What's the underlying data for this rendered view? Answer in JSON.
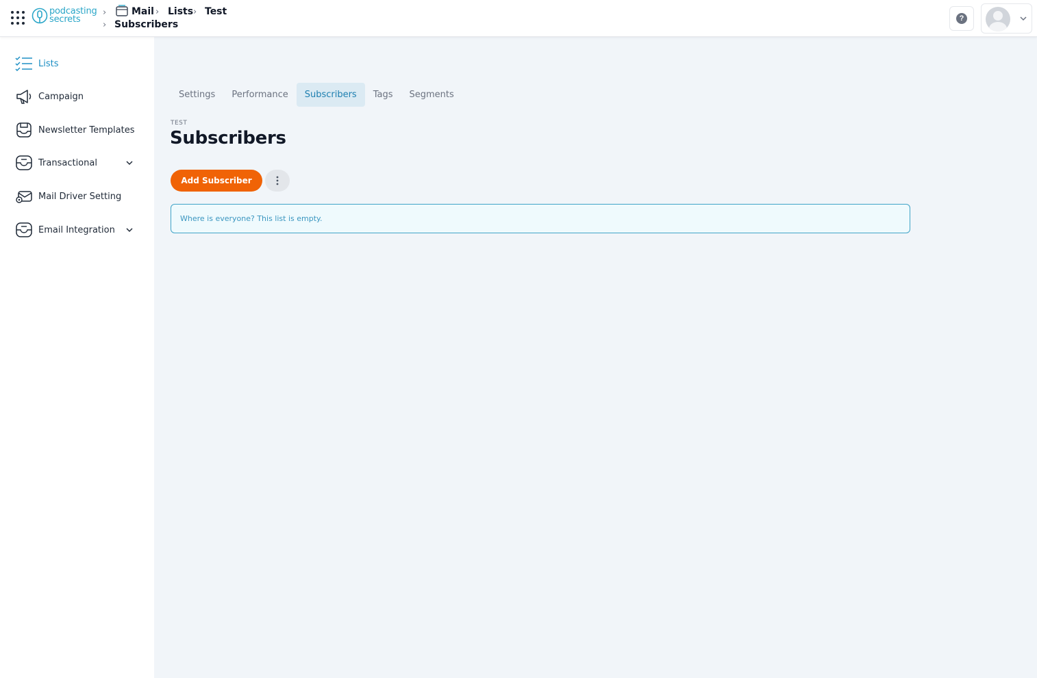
{
  "app": {
    "logo_line1": "podcasting",
    "logo_line2": "secrets"
  },
  "breadcrumb": [
    {
      "label": "Mail"
    },
    {
      "label": "Lists"
    },
    {
      "label": "Test"
    },
    {
      "label": "Subscribers"
    }
  ],
  "header": {
    "help_label": "?",
    "help_icon": "help-icon",
    "user_icon": "avatar"
  },
  "sidebar": {
    "items": [
      {
        "label": "Lists",
        "icon": "list-check-icon",
        "active": true
      },
      {
        "label": "Campaign",
        "icon": "megaphone-icon"
      },
      {
        "label": "Newsletter Templates",
        "icon": "template-icon"
      },
      {
        "label": "Transactional",
        "icon": "inbox-icon",
        "expandable": true
      },
      {
        "label": "Mail Driver Setting",
        "icon": "mail-settings-icon"
      },
      {
        "label": "Email Integration",
        "icon": "inbox-icon",
        "expandable": true
      }
    ]
  },
  "tabs": [
    {
      "label": "Settings"
    },
    {
      "label": "Performance"
    },
    {
      "label": "Subscribers",
      "active": true
    },
    {
      "label": "Tags"
    },
    {
      "label": "Segments"
    }
  ],
  "page": {
    "overline": "TEST",
    "title": "Subscribers",
    "add_button": "Add Subscriber",
    "empty_message": "Where is everyone? This list is empty."
  },
  "colors": {
    "accent": "#1d8fc4",
    "primary_button": "#f06306",
    "background": "#f1f5f9",
    "alert_border": "#3fa3c7"
  }
}
